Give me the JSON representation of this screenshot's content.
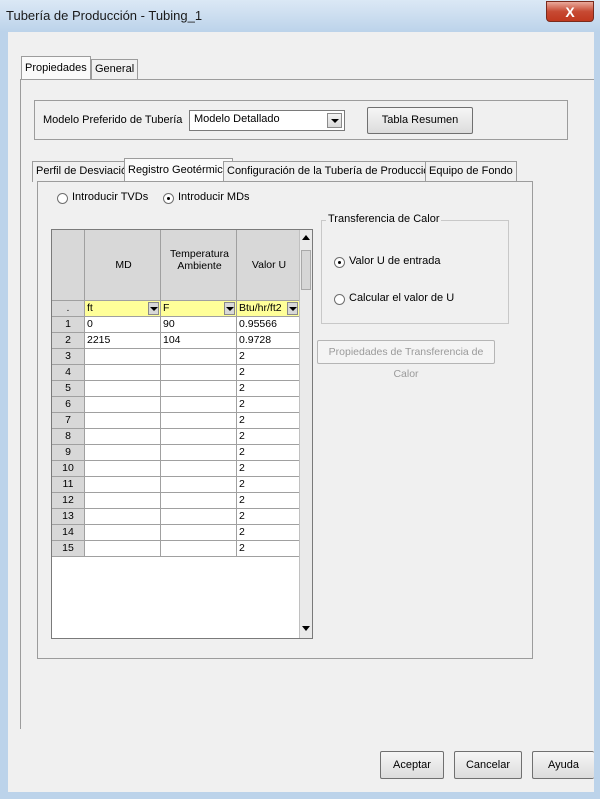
{
  "window": {
    "title": "Tubería de Producción - Tubing_1",
    "close_label": "X"
  },
  "outer_tabs": [
    {
      "label": "Propiedades"
    },
    {
      "label": "General"
    }
  ],
  "preferred_model": {
    "label": "Modelo Preferido de Tubería",
    "value": "Modelo Detallado",
    "summary_button": "Tabla Resumen"
  },
  "inner_tabs": [
    {
      "label": "Perfil de Desviación"
    },
    {
      "label": "Registro Geotérmico"
    },
    {
      "label": "Configuración de la Tubería de Producción"
    },
    {
      "label": "Equipo de Fondo"
    }
  ],
  "input_mode": {
    "options": [
      {
        "label": "Introducir TVDs",
        "checked": false
      },
      {
        "label": "Introducir MDs",
        "checked": true
      }
    ]
  },
  "grid": {
    "corner": ".",
    "headers": [
      "MD",
      "Temperatura Ambiente",
      "Valor U"
    ],
    "units": [
      "ft",
      "F",
      "Btu/hr/ft2"
    ],
    "rows": [
      {
        "num": "1",
        "md": "0",
        "temp": "90",
        "u": "0.95566"
      },
      {
        "num": "2",
        "md": "2215",
        "temp": "104",
        "u": "0.9728"
      },
      {
        "num": "3",
        "md": "",
        "temp": "",
        "u": "2"
      },
      {
        "num": "4",
        "md": "",
        "temp": "",
        "u": "2"
      },
      {
        "num": "5",
        "md": "",
        "temp": "",
        "u": "2"
      },
      {
        "num": "6",
        "md": "",
        "temp": "",
        "u": "2"
      },
      {
        "num": "7",
        "md": "",
        "temp": "",
        "u": "2"
      },
      {
        "num": "8",
        "md": "",
        "temp": "",
        "u": "2"
      },
      {
        "num": "9",
        "md": "",
        "temp": "",
        "u": "2"
      },
      {
        "num": "10",
        "md": "",
        "temp": "",
        "u": "2"
      },
      {
        "num": "11",
        "md": "",
        "temp": "",
        "u": "2"
      },
      {
        "num": "12",
        "md": "",
        "temp": "",
        "u": "2"
      },
      {
        "num": "13",
        "md": "",
        "temp": "",
        "u": "2"
      },
      {
        "num": "14",
        "md": "",
        "temp": "",
        "u": "2"
      },
      {
        "num": "15",
        "md": "",
        "temp": "",
        "u": "2"
      }
    ]
  },
  "heat_transfer": {
    "title": "Transferencia de Calor",
    "options": [
      {
        "label": "Valor U de entrada",
        "checked": true
      },
      {
        "label": "Calcular el valor de U",
        "checked": false
      }
    ],
    "properties_button": "Propiedades de Transferencia de Calor"
  },
  "footer": {
    "accept": "Aceptar",
    "cancel": "Cancelar",
    "help": "Ayuda"
  }
}
